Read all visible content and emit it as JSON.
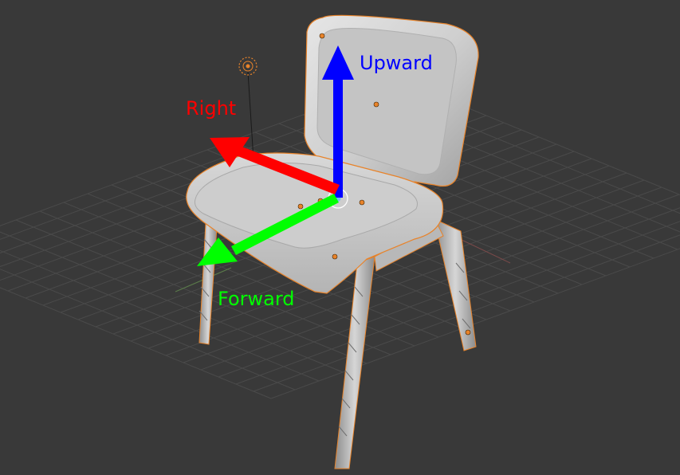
{
  "viewport": {
    "background": "#393939",
    "grid_color": "#4a4a4a",
    "selection_outline": "#e8832a"
  },
  "scene": {
    "object": "chair",
    "lamp": "lamp-icon",
    "origin": "object-origin"
  },
  "axes": {
    "upward": {
      "label": "Upward",
      "color": "#0000ff"
    },
    "right": {
      "label": "Right",
      "color": "#ff0000"
    },
    "forward": {
      "label": "Forward",
      "color": "#00ff00"
    }
  }
}
